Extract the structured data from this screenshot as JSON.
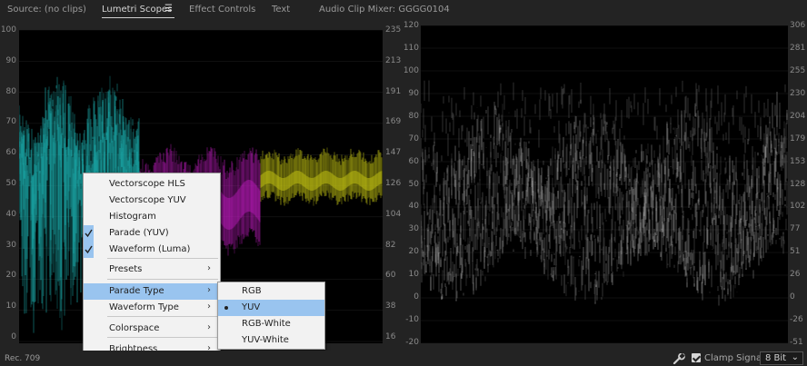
{
  "tabs": [
    {
      "label": "Source: (no clips)",
      "active": false
    },
    {
      "label": "Lumetri Scopes",
      "active": true
    },
    {
      "label": "Effect Controls",
      "active": false
    },
    {
      "label": "Text",
      "active": false
    },
    {
      "label": "Audio Clip Mixer: GGGG0104",
      "active": false
    }
  ],
  "tab_menu_icon": "hamburger-icon",
  "left_scope": {
    "left_axis": [
      "100",
      "90",
      "80",
      "70",
      "60",
      "50",
      "40",
      "30",
      "20",
      "10",
      "0"
    ],
    "right_axis": [
      "235",
      "213",
      "191",
      "169",
      "147",
      "126",
      "104",
      "82",
      "60",
      "38",
      "16"
    ],
    "channel_colors": {
      "y": "#1aa8a8",
      "u": "#b81ab8",
      "v": "#b8b812"
    }
  },
  "right_scope": {
    "left_axis": [
      "120",
      "110",
      "100",
      "90",
      "80",
      "70",
      "60",
      "50",
      "40",
      "30",
      "20",
      "10",
      "0",
      "-10",
      "-20"
    ],
    "right_axis": [
      "306",
      "281",
      "255",
      "230",
      "204",
      "179",
      "153",
      "128",
      "102",
      "77",
      "51",
      "26",
      "0",
      "-26",
      "-51"
    ]
  },
  "context_menu": {
    "items": [
      {
        "label": "Vectorscope HLS",
        "checked": false,
        "submenu": false
      },
      {
        "label": "Vectorscope YUV",
        "checked": false,
        "submenu": false
      },
      {
        "label": "Histogram",
        "checked": false,
        "submenu": false
      },
      {
        "label": "Parade (YUV)",
        "checked": true,
        "submenu": false
      },
      {
        "label": "Waveform (Luma)",
        "checked": true,
        "submenu": false
      },
      {
        "label": "Presets",
        "checked": false,
        "submenu": true
      },
      {
        "label": "Parade Type",
        "checked": false,
        "submenu": true,
        "highlighted": true
      },
      {
        "label": "Waveform Type",
        "checked": false,
        "submenu": true
      },
      {
        "label": "Colorspace",
        "checked": false,
        "submenu": true
      },
      {
        "label": "Brightness",
        "checked": false,
        "submenu": true
      }
    ]
  },
  "submenu": {
    "items": [
      {
        "label": "RGB",
        "selected": false
      },
      {
        "label": "YUV",
        "selected": true
      },
      {
        "label": "RGB-White",
        "selected": false
      },
      {
        "label": "YUV-White",
        "selected": false
      }
    ]
  },
  "bottom": {
    "status": "Rec. 709",
    "clamp_signal_label": "Clamp Signal",
    "clamp_signal_checked": true,
    "bit_depth": "8 Bit"
  },
  "colors": {
    "accent_highlight": "#99c4ef",
    "panel_bg": "#232323"
  }
}
